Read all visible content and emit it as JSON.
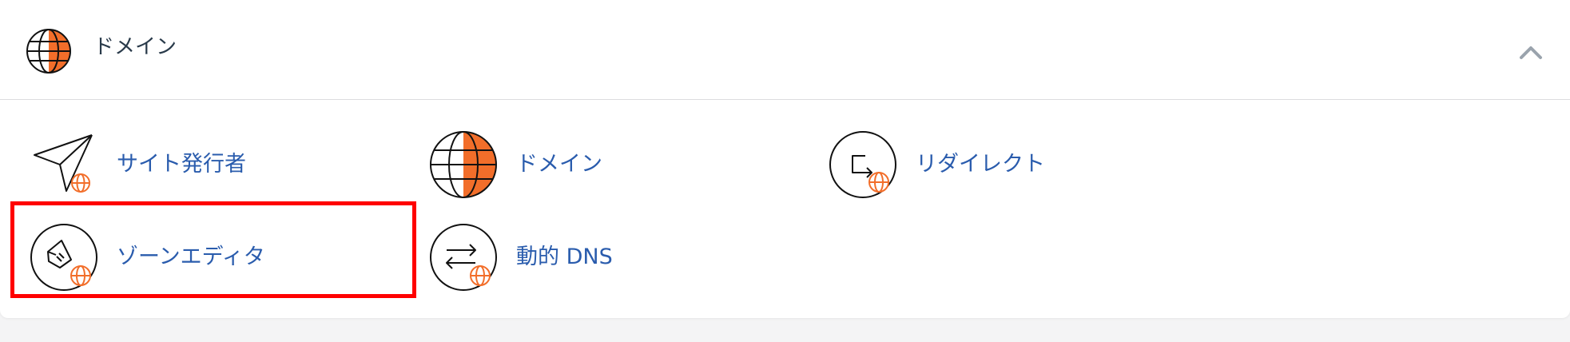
{
  "section": {
    "title": "ドメイン",
    "icon": "domain-globe-icon",
    "collapse_icon": "chevron-up-icon"
  },
  "items": [
    {
      "label": "サイト発行者",
      "icon": "site-publisher-icon"
    },
    {
      "label": "ドメイン",
      "icon": "domain-globe-icon"
    },
    {
      "label": "リダイレクト",
      "icon": "redirect-icon"
    },
    {
      "label": "ゾーンエディタ",
      "icon": "zone-editor-icon"
    },
    {
      "label": "動的 DNS",
      "icon": "dynamic-dns-icon"
    }
  ],
  "colors": {
    "accent_orange": "#f26e2a",
    "link_blue": "#2a5cad",
    "title_text": "#293a4a",
    "highlight_red": "#ff0000"
  }
}
